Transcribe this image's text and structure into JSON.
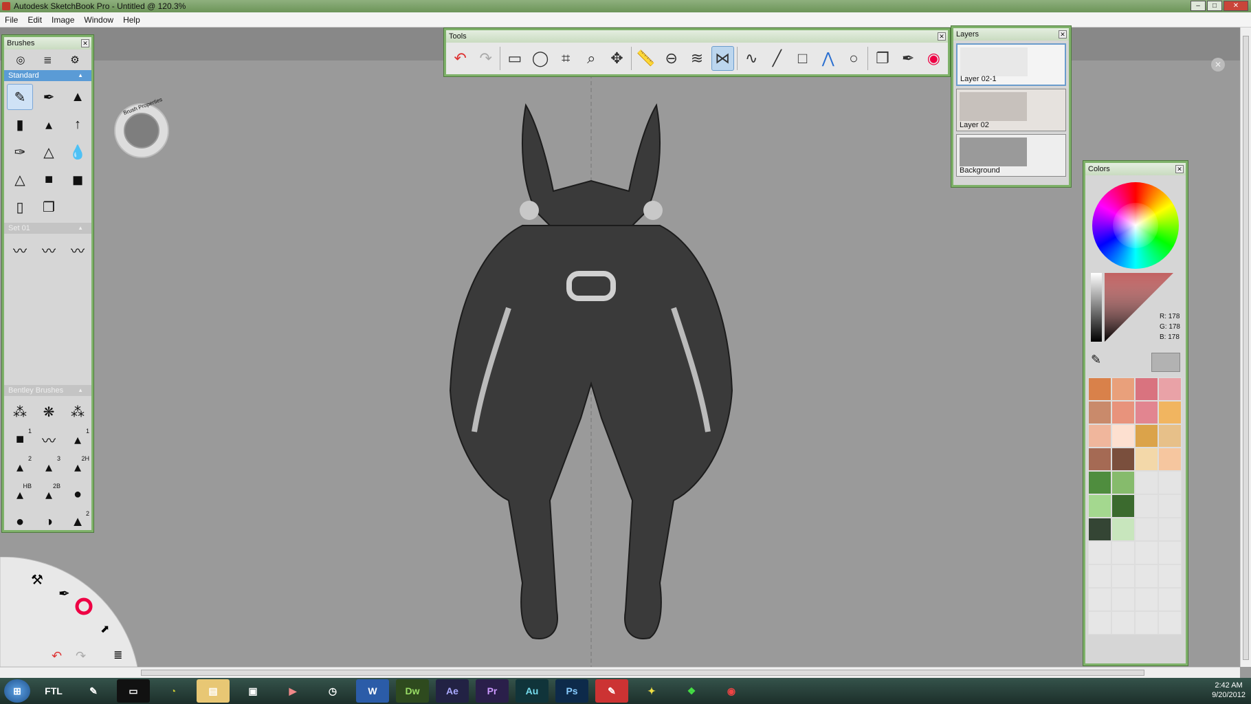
{
  "window": {
    "title": "Autodesk SketchBook Pro - Untitled @ 120.3%"
  },
  "menu": [
    "File",
    "Edit",
    "Image",
    "Window",
    "Help"
  ],
  "brushes": {
    "title": "Brushes",
    "sections": [
      "Standard",
      "Set 01",
      "Bentley Brushes"
    ],
    "bentley_labels": [
      "1",
      "1",
      "2",
      "3",
      "2H",
      "HB",
      "2B",
      "2"
    ]
  },
  "brush_properties": "Brush Properties",
  "tools": {
    "title": "Tools"
  },
  "layers": {
    "title": "Layers",
    "items": [
      "Layer 02-1",
      "Layer 02",
      "Background"
    ]
  },
  "colors": {
    "title": "Colors",
    "r_label": "R:",
    "g_label": "G:",
    "b_label": "B:",
    "r": "178",
    "g": "178",
    "b": "178",
    "swatches": [
      "#d9814a",
      "#e9a07b",
      "#d9737f",
      "#e9a2a7",
      "#c98a6b",
      "#e8937c",
      "#e28590",
      "#f1b560",
      "#f0b69c",
      "#fde0d0",
      "#dba34a",
      "#e7c089",
      "#a56a54",
      "#7a4f3d",
      "#f3d8a9",
      "#f6c69f",
      "#4f8d3e",
      "#86bb6c",
      "#e4e4e4",
      "#e4e4e4",
      "#a4d88f",
      "#3b6a2e",
      "#e4e4e4",
      "#e4e4e4",
      "#344534",
      "#c8e6bd",
      "#e4e4e4",
      "#e4e4e4"
    ]
  },
  "taskbar": {
    "items": [
      "FTL",
      "Dw",
      "Ae",
      "Pr",
      "Au",
      "Ps"
    ],
    "time": "2:42 AM",
    "date": "9/20/2012"
  }
}
